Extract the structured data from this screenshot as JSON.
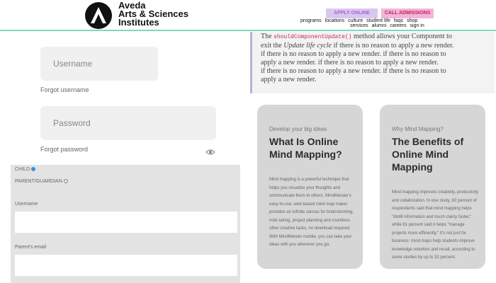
{
  "header": {
    "brand_line1": "Aveda",
    "brand_line2": "Arts & Sciences",
    "brand_line3": "Institutes",
    "apply_label": "APPLY ONLINE",
    "call_label": "CALL ADMISSIONS",
    "nav_primary": [
      "programs",
      "locations",
      "culture",
      "student life",
      "faqs",
      "shop"
    ],
    "nav_secondary": [
      "services",
      "alumni",
      "careers",
      "sign in"
    ]
  },
  "login": {
    "username_placeholder": "Username",
    "forgot_username": "Forgot username",
    "password_placeholder": "Password",
    "forgot_password": "Forgot password"
  },
  "form": {
    "radio_child": "CHILD",
    "radio_parent": "PARENT/GUARDIAN",
    "username_label": "Username",
    "email_label": "Parent's email"
  },
  "snippet": {
    "prefix": "The",
    "code": "shouldComponentUpdate()",
    "line1_rest": "method allows your Component to",
    "line2_start": "exit the",
    "line2_em": "Update life cycle",
    "line2_rest": "if there is no reason to apply a new render.",
    "repeat_lines": [
      "if there is no reason to apply a new render. if there is no reason to",
      "apply a new render. if there is no reason to apply a new render.",
      "if there is no reason to apply a new render. if there is no reason to",
      "apply a new render."
    ]
  },
  "cards": [
    {
      "eyebrow": "Develop your big ideas",
      "title": "What Is Online Mind Mapping?",
      "body": "Mind mapping is a powerful technique that helps you visualize your thoughts and communicate them to others. MindMeister's easy-to-use, web-based mind map maker provides an infinite canvas for brainstorming, note taking, project planning and countless other creative tasks, no download required. With MindMeister mobile, you can take your ideas with you wherever you go."
    },
    {
      "eyebrow": "Why Mind Mapping?",
      "title": "The Benefits of Online Mind Mapping",
      "body": "Mind mapping improves creativity, productivity and collaboration. In one study, 82 percent of respondents said that mind mapping helps \"distill information and much clarity faster,\" while 81 percent said it helps \"manage projects more efficiently.\" It's not just for business: mind maps help students improve knowledge retention and recall, according to some studies by up to 32 percent."
    }
  ],
  "colors": {
    "accent_line": "#7fd6c2",
    "apply_bg": "#d8c8f0",
    "call_bg": "#f3b5d8",
    "radio_selected": "#3a8ee6"
  }
}
